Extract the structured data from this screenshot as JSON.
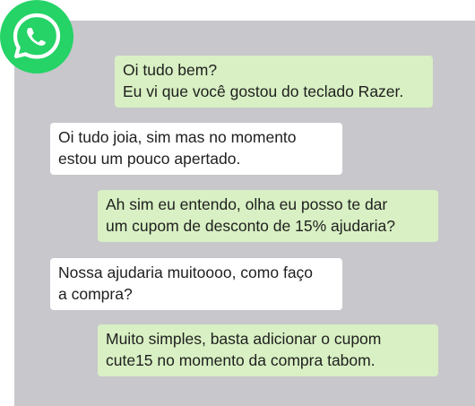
{
  "app": {
    "logo_icon": "whatsapp-logo-icon",
    "brand_color": "#25d366",
    "panel_color": "#c8c7cc"
  },
  "messages": [
    {
      "direction": "outgoing",
      "text": "Oi tudo bem?\nEu vi que você gostou do teclado Razer."
    },
    {
      "direction": "incoming",
      "text": "Oi tudo joia, sim mas no momento\nestou um pouco apertado."
    },
    {
      "direction": "outgoing",
      "text": "Ah sim eu entendo, olha eu posso te dar\num cupom de desconto de 15% ajudaria?"
    },
    {
      "direction": "incoming",
      "text": "Nossa ajudaria muitoooo, como faço\na compra?"
    },
    {
      "direction": "outgoing",
      "text": "Muito simples, basta adicionar o cupom\ncute15 no momento da compra tabom."
    }
  ],
  "colors": {
    "outgoing_bubble": "#d8f0c3",
    "incoming_bubble": "#ffffff"
  }
}
